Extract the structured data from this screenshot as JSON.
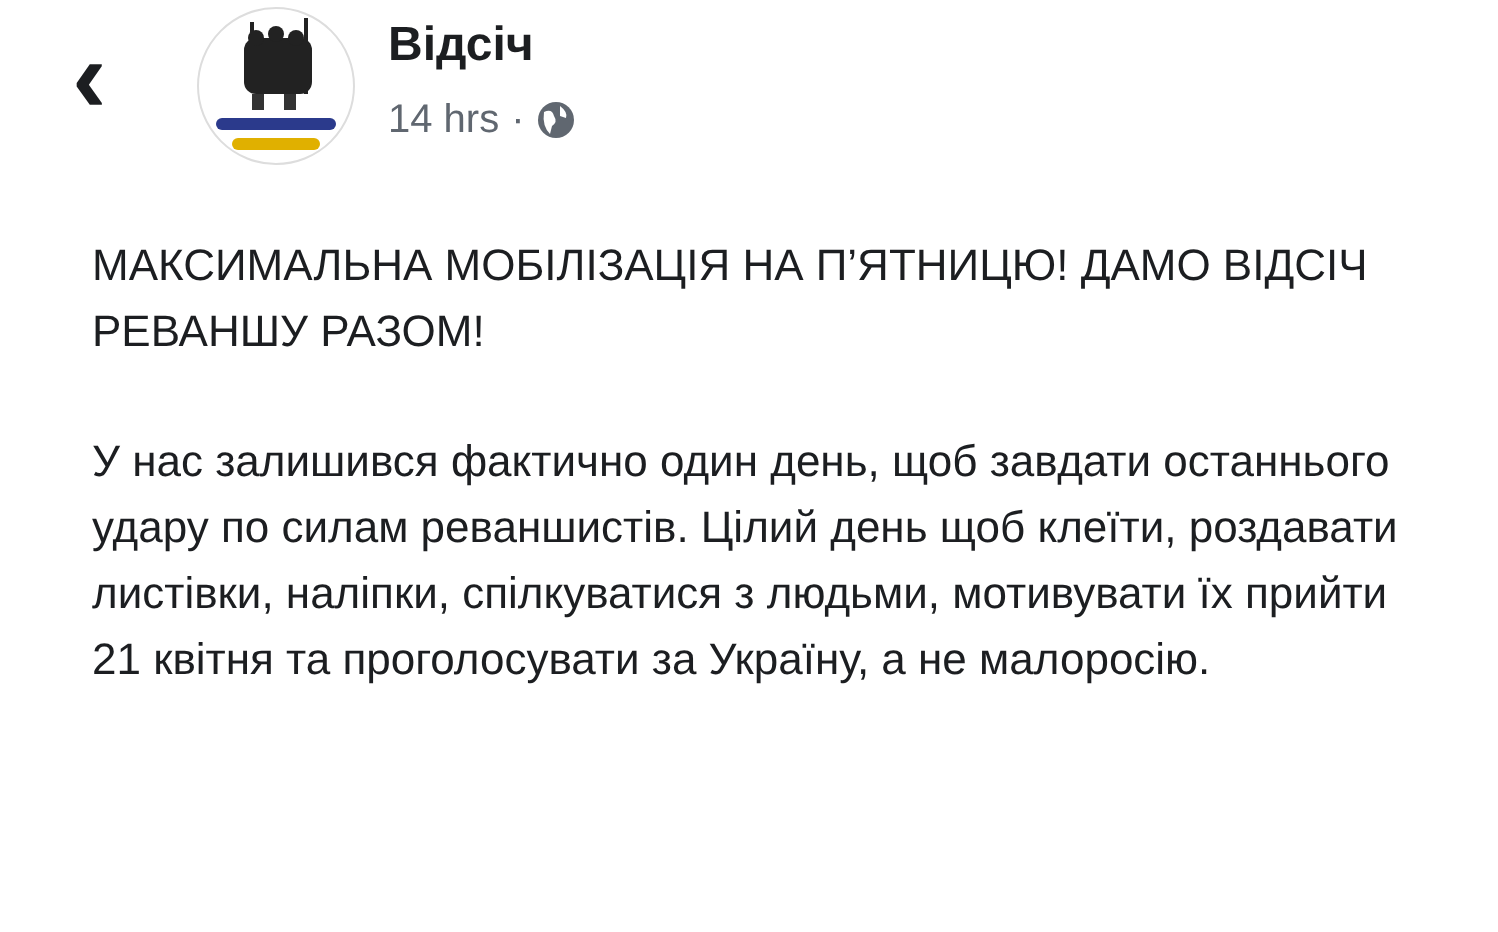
{
  "header": {
    "back": "‹",
    "page_name": "Відсіч",
    "time": "14 hrs",
    "separator": "·"
  },
  "post": {
    "paragraphs": [
      "МАКСИМАЛЬНА МОБІЛІЗАЦІЯ НА П’ЯТНИЦЮ! ДАМО ВІДСІЧ РЕВАНШУ РАЗОМ!",
      "У нас залишився фактично один день, щоб завдати останнього удару по силам реваншистів. Цілий день щоб клеїти, роздавати листівки, наліпки, спілкуватися з людьми, мотивувати їх прийти 21 квітня та проголосувати за Україну, а не малоросію."
    ]
  }
}
